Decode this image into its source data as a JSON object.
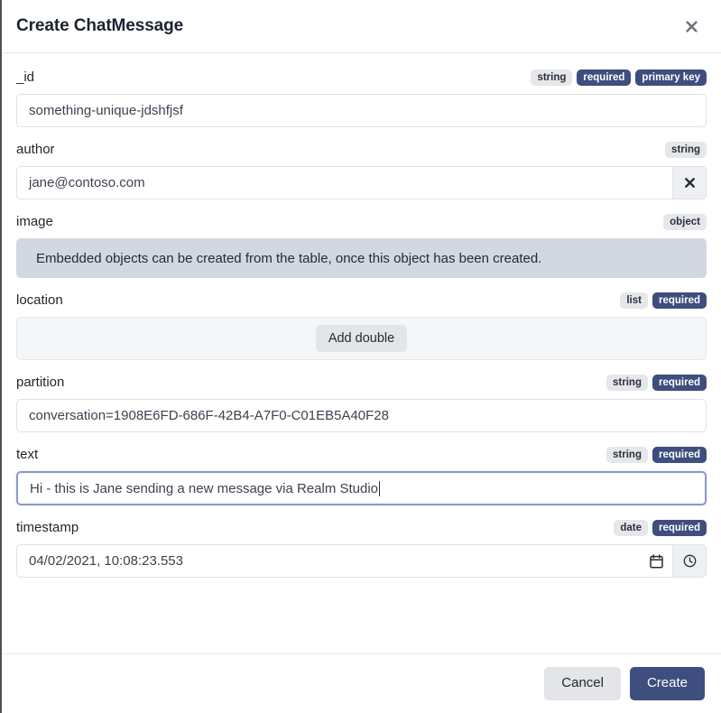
{
  "dialog": {
    "title": "Create ChatMessage",
    "close_icon": "close-icon"
  },
  "fields": [
    {
      "name": "_id",
      "label": "_id",
      "badges": [
        {
          "text": "string",
          "kind": "type"
        },
        {
          "text": "required",
          "kind": "flag"
        },
        {
          "text": "primary key",
          "kind": "flag"
        }
      ],
      "value": "something-unique-jdshfjsf"
    },
    {
      "name": "author",
      "label": "author",
      "badges": [
        {
          "text": "string",
          "kind": "type"
        }
      ],
      "value": "jane@contoso.com",
      "clear_icon": "clear-icon"
    },
    {
      "name": "image",
      "label": "image",
      "badges": [
        {
          "text": "object",
          "kind": "type"
        }
      ],
      "notice": "Embedded objects can be created from the table, once this object has been created."
    },
    {
      "name": "location",
      "label": "location",
      "badges": [
        {
          "text": "list",
          "kind": "type"
        },
        {
          "text": "required",
          "kind": "flag"
        }
      ],
      "add_button": "Add double"
    },
    {
      "name": "partition",
      "label": "partition",
      "badges": [
        {
          "text": "string",
          "kind": "type"
        },
        {
          "text": "required",
          "kind": "flag"
        }
      ],
      "value": "conversation=1908E6FD-686F-42B4-A7F0-C01EB5A40F28"
    },
    {
      "name": "text",
      "label": "text",
      "badges": [
        {
          "text": "string",
          "kind": "type"
        },
        {
          "text": "required",
          "kind": "flag"
        }
      ],
      "value": "Hi - this is Jane sending a new message via Realm Studio",
      "focused": true
    },
    {
      "name": "timestamp",
      "label": "timestamp",
      "badges": [
        {
          "text": "date",
          "kind": "type"
        },
        {
          "text": "required",
          "kind": "flag"
        }
      ],
      "value": "04/02/2021, 10:08:23.553",
      "calendar_icon": "calendar-icon",
      "clock_icon": "clock-icon"
    }
  ],
  "footer": {
    "cancel_label": "Cancel",
    "create_label": "Create"
  },
  "colors": {
    "accent": "#3e4e7e",
    "badge_type_bg": "#e5e7eb",
    "notice_bg": "#d2d8e1",
    "focus_border": "#8e98cb"
  }
}
